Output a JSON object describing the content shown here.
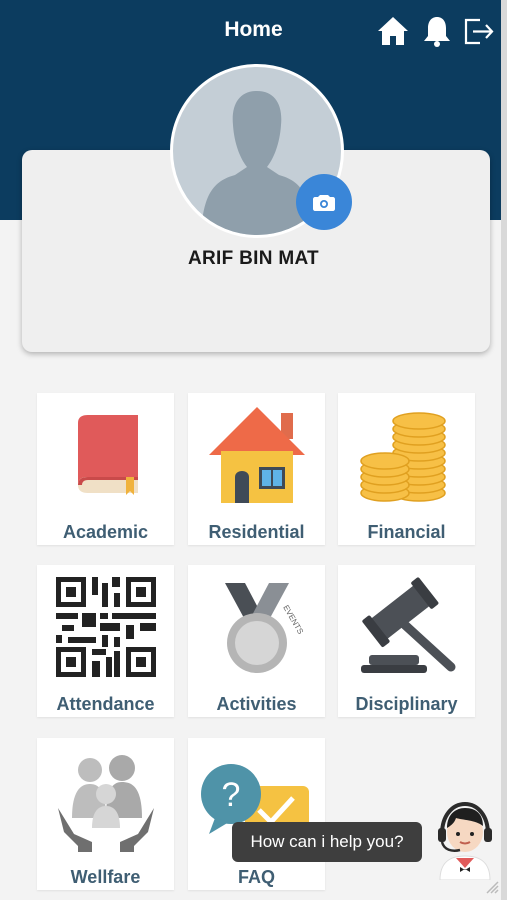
{
  "header": {
    "title": "Home",
    "icons": [
      "home-icon",
      "bell-icon",
      "logout-icon"
    ],
    "background": "#0c3c5f"
  },
  "profile": {
    "name": "ARIF BIN MAT"
  },
  "menu": {
    "tiles": [
      {
        "label": "Academic",
        "icon": "book-icon"
      },
      {
        "label": "Residential",
        "icon": "house-icon"
      },
      {
        "label": "Financial",
        "icon": "coins-icon"
      },
      {
        "label": "Attendance",
        "icon": "qr-code-icon"
      },
      {
        "label": "Activities",
        "icon": "medal-icon"
      },
      {
        "label": "Disciplinary",
        "icon": "gavel-icon"
      },
      {
        "label": "Wellfare",
        "icon": "family-icon"
      },
      {
        "label": "FAQ",
        "icon": "question-chat-icon"
      }
    ],
    "label_color": "#3f5e73"
  },
  "assistant": {
    "prompt": "How can i help you?"
  }
}
